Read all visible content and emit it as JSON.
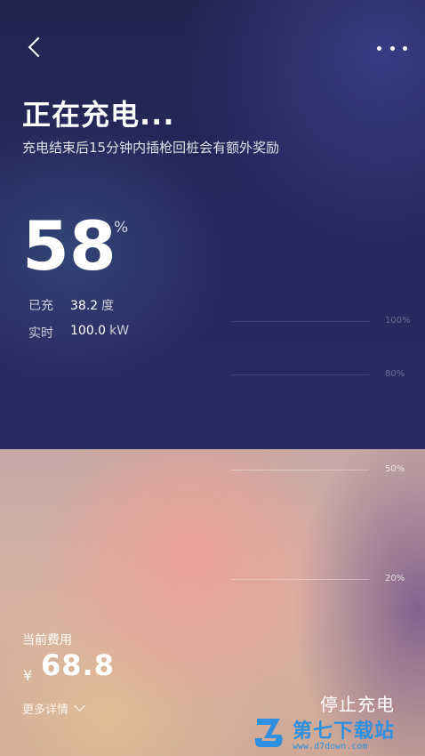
{
  "header": {
    "back_icon": "chevron-left-icon",
    "more_icon": "more-horizontal-icon"
  },
  "status": {
    "title": "正在充电...",
    "subtitle": "充电结束后15分钟内插枪回桩会有额外奖励"
  },
  "battery": {
    "percent": "58",
    "percent_unit": "%"
  },
  "stats": {
    "charged_label": "已充",
    "charged_value": "38.2",
    "charged_unit": "度",
    "power_label": "实时",
    "power_value": "100.0",
    "power_unit": "kW"
  },
  "gauge": {
    "ticks": [
      "100%",
      "80%",
      "50%",
      "20%"
    ]
  },
  "cost": {
    "label": "当前费用",
    "currency": "¥",
    "value": "68.8",
    "details_label": "更多详情"
  },
  "actions": {
    "stop_label": "停止充电"
  },
  "watermark": {
    "text": "第七下载站",
    "url": "www.d7down.com"
  }
}
